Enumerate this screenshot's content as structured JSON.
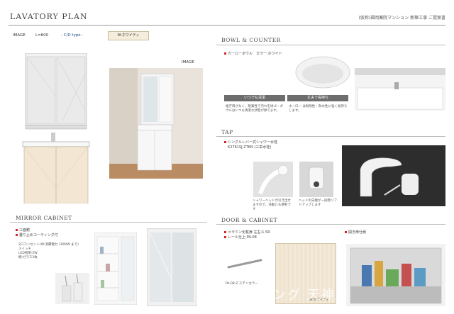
{
  "header": {
    "title": "LAVATORY PLAN",
    "project": "(仮称)福岡薬院マンション 新築工事 ご提案書"
  },
  "left": {
    "image_label": "IMAGE",
    "size_label": "L=600",
    "type_label": "- C/D type -",
    "color_badge": "W:ホワイティ",
    "photo_label": "IMAGE"
  },
  "bowl": {
    "title": "BOWL & COUNTER",
    "spec": "カーローボウル　カラー:ホワイト",
    "btn1": "いつでも清潔",
    "btn2": "丈夫で長持ち",
    "desc1": "継ぎ目がなく、耐薬性で汚れを拭ゴ・ボウルはいつも清潔な状態が保てます。",
    "desc2": "ホーロー は耐熱性・耐水性に強く長持ちします。"
  },
  "tap": {
    "title": "TAP",
    "spec1": "シングルレバー式シャワー水栓",
    "spec2": "K2761SJ-ZTKN (三栄水栓)",
    "caption1": "シャワーヘッドが引き出せますので、洗髪にも便利です",
    "caption2": "ヘッドの先端が一段階リフトアップします"
  },
  "mirror": {
    "title": "MIRROR CABINET",
    "spec1": "三面鏡",
    "spec2": "曇り止めコーティング付",
    "items": [
      "2口コンセント(W:消費電力 1000W まで)",
      "スイッチ",
      "LED照明:5W",
      "棚:ガラス3枚"
    ]
  },
  "door": {
    "title": "DOOR & CABINET",
    "spec1": "メラミン化粧扉 左右:1.5R",
    "spec2": "レール仕上:PA-08",
    "handle_label": "PA-08-Z ステンカラー",
    "color_label": "W:ホワイティ",
    "right_spec": "開き扉仕様"
  },
  "watermark": "スリビング 天神店"
}
